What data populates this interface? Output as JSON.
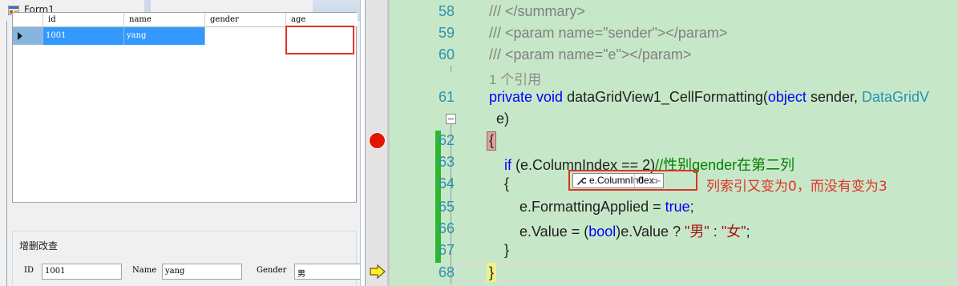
{
  "form": {
    "title": "Form1",
    "grid": {
      "columns": [
        "id",
        "name",
        "gender",
        "age"
      ],
      "rows": [
        {
          "id": "1001",
          "name": "yang",
          "gender": "",
          "age": ""
        }
      ]
    },
    "group_title": "增删改查",
    "fields": {
      "id_label": "ID",
      "id_value": "1001",
      "name_label": "Name",
      "name_value": "yang",
      "gender_label": "Gender",
      "gender_value": "男"
    }
  },
  "editor": {
    "lines": [
      {
        "num": "58",
        "text": "/// </summary>"
      },
      {
        "num": "59",
        "text": "/// <param name=\"sender\"></param>"
      },
      {
        "num": "60",
        "text": "/// <param name=\"e\"></param>"
      },
      {
        "num": "",
        "text": "1 个引用"
      },
      {
        "num": "61",
        "k1": "private",
        "k2": "void",
        "text": "dataGridView1_CellFormatting(",
        "k3": "object",
        "text2": "sender,",
        "t1": "DataGridV"
      },
      {
        "num": "",
        "text": "e)"
      },
      {
        "num": "62",
        "text": "{"
      },
      {
        "num": "63",
        "k1": "if",
        "text": "(e.ColumnIndex == 2)",
        "comment": "//性别gender在第二列"
      },
      {
        "num": "64",
        "text": "{"
      },
      {
        "num": "65",
        "text": "e.FormattingApplied =",
        "k1": "true",
        "text2": ";"
      },
      {
        "num": "66",
        "text": "e.Value = (",
        "k1": "bool",
        "text2": ")e.Value ?",
        "s1": "\"男\"",
        "text3": ":",
        "s2": "\"女\"",
        "text4": ";"
      },
      {
        "num": "67",
        "text": "}"
      },
      {
        "num": "68",
        "text": "}"
      }
    ],
    "datatip": {
      "expression": "e.ColumnIndex",
      "value": "0"
    },
    "annotation": "列索引又变为0，而没有变为3"
  },
  "colors": {
    "breakpoint": "#e51400",
    "highlight_box": "#e0312b",
    "editor_bg": "#c7e8c8",
    "selection": "#3399ff"
  }
}
